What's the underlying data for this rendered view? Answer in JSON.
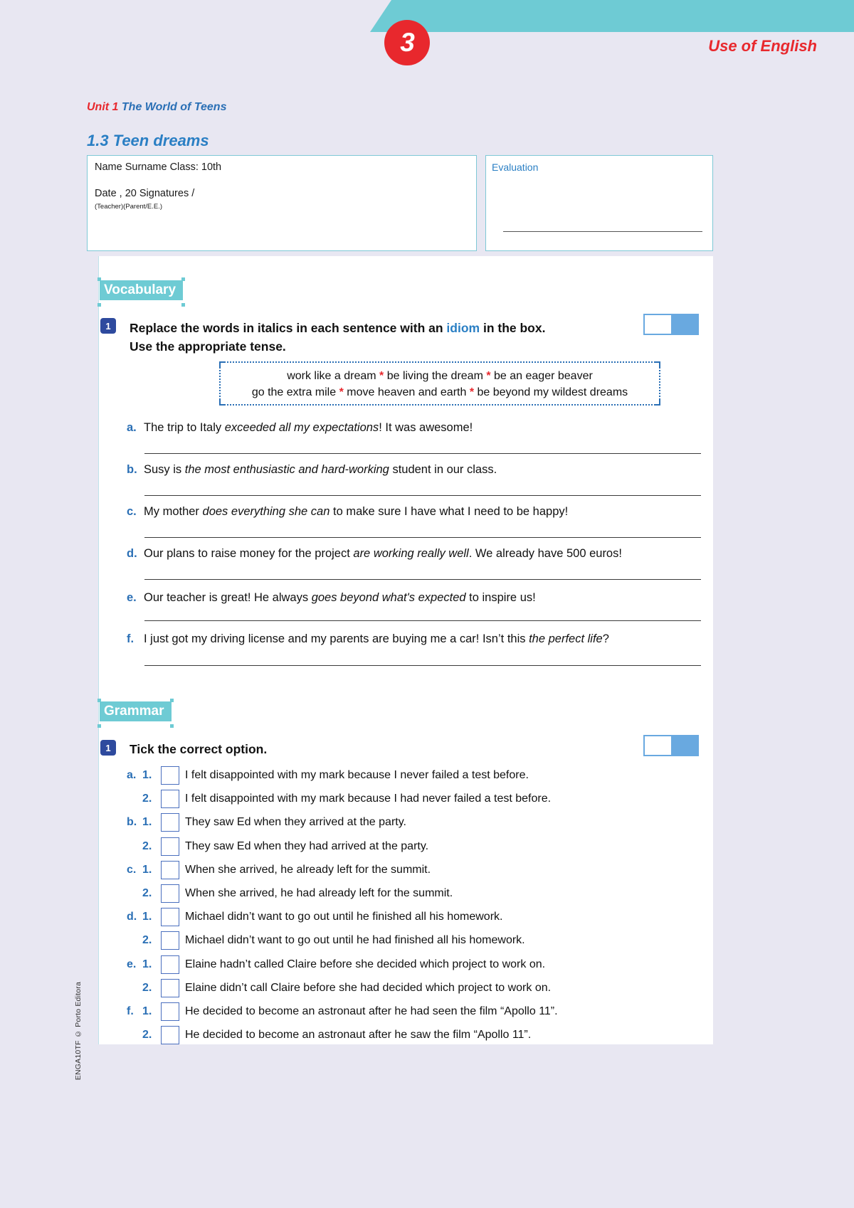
{
  "header": {
    "number": "3",
    "title": "Use of English",
    "band_color": "#6ecbd4",
    "accent_red": "#e8282d"
  },
  "unit": {
    "label": "Unit 1",
    "name": "The World of Teens",
    "lesson": "1.3 Teen dreams"
  },
  "identification": {
    "line1": "Name   Surname   Class: 10th",
    "line2": "Date  , 20    Signatures   /",
    "line3": "(Teacher)(Parent/E.E.)",
    "evaluation_label": "Evaluation"
  },
  "vocabulary": {
    "section_label": "Vocabulary",
    "exercise_number": "1",
    "instruction_part1": "Replace the words in italics in each sentence with an ",
    "instruction_highlight": "idiom",
    "instruction_part2": " in the box.",
    "instruction_line2": "Use the appropriate tense.",
    "word_box": {
      "separator": "*",
      "rows": [
        [
          "work like a dream",
          "be living the dream",
          "be an eager beaver"
        ],
        [
          "go the extra mile",
          "move heaven and earth",
          "be beyond my wildest dreams"
        ]
      ]
    },
    "items": [
      {
        "letter": "a.",
        "before": "The trip to Italy ",
        "italic": "exceeded all my expectations",
        "after": "! It was awesome!"
      },
      {
        "letter": "b.",
        "before": "Susy is ",
        "italic": "the most enthusiastic and hard-working",
        "after": " student in our class."
      },
      {
        "letter": "c.",
        "before": "My mother ",
        "italic": "does everything she can",
        "after": " to make sure I have what I need to be happy!"
      },
      {
        "letter": "d.",
        "before": "Our plans to raise money for the project ",
        "italic": "are working really well",
        "after": ". We already have 500 euros!"
      },
      {
        "letter": "e.",
        "before": "Our teacher is great! He always ",
        "italic": "goes beyond what's expected",
        "after": " to inspire us!"
      },
      {
        "letter": "f.",
        "before": "I just got my driving license and my parents are buying me a car! Isn’t this ",
        "italic": "the perfect life",
        "after": "?"
      }
    ]
  },
  "grammar": {
    "section_label": "Grammar",
    "exercise_number": "1",
    "instruction": "Tick the correct option.",
    "items": [
      {
        "letter": "a.",
        "number": "1.",
        "text": "I felt disappointed with my mark because I never failed a test before."
      },
      {
        "letter": "",
        "number": "2.",
        "text": "I felt disappointed with my mark because I had never failed a test before."
      },
      {
        "letter": "b.",
        "number": "1.",
        "text": "They saw Ed when they arrived at the party."
      },
      {
        "letter": "",
        "number": "2.",
        "text": "They saw Ed when they had arrived at the party."
      },
      {
        "letter": "c.",
        "number": "1.",
        "text": "When she arrived, he already left for the summit."
      },
      {
        "letter": "",
        "number": "2.",
        "text": "When she arrived, he had already left for the summit."
      },
      {
        "letter": "d.",
        "number": "1.",
        "text": "Michael didn’t want to go out until he finished all his homework."
      },
      {
        "letter": "",
        "number": "2.",
        "text": "Michael didn’t want to go out until he had finished all his homework."
      },
      {
        "letter": "e.",
        "number": "1.",
        "text": "Elaine hadn’t called Claire before she decided which project to work on."
      },
      {
        "letter": "",
        "number": "2.",
        "text": "Elaine didn’t call Claire before she had decided which project to work on."
      },
      {
        "letter": "f.",
        "number": "1.",
        "text": "He decided to become an astronaut after he had seen the film “Apollo 11”."
      },
      {
        "letter": "",
        "number": "2.",
        "text": "He decided to become an astronaut after he saw the film “Apollo 11”."
      }
    ]
  },
  "footer": {
    "credit": "ENGA10TF © Porto Editora"
  }
}
